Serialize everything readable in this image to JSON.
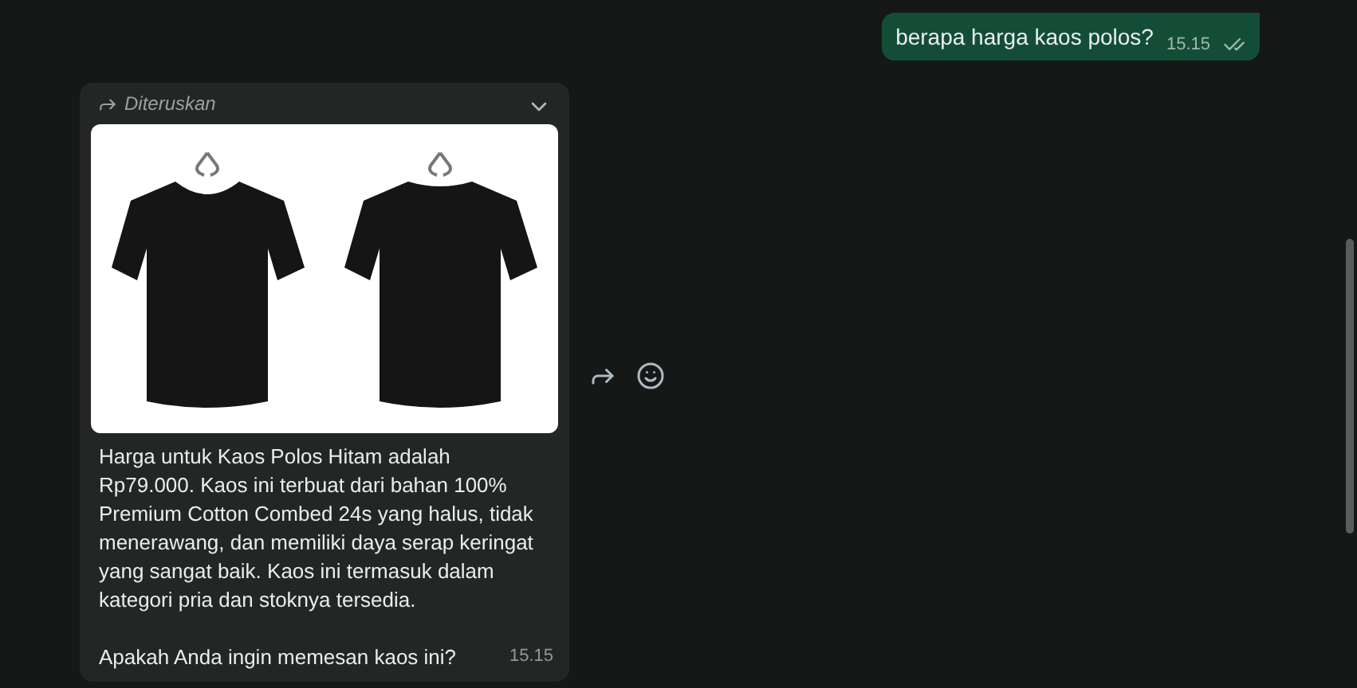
{
  "messages": [
    {
      "kind": "outgoing",
      "text": "berapa harga kaos polos?",
      "time": "15.15",
      "read": true
    },
    {
      "kind": "incoming",
      "forwarded_label": "Diteruskan",
      "paragraphs": [
        "Harga untuk Kaos Polos Hitam adalah Rp79.000. Kaos ini terbuat dari bahan 100% Premium Cotton Combed 24s yang halus, tidak menerawang, dan memiliki daya serap keringat yang sangat baik. Kaos ini termasuk dalam kategori pria dan stoknya tersedia.",
        "Apakah Anda ingin memesan kaos ini?"
      ],
      "time": "15.15"
    }
  ]
}
